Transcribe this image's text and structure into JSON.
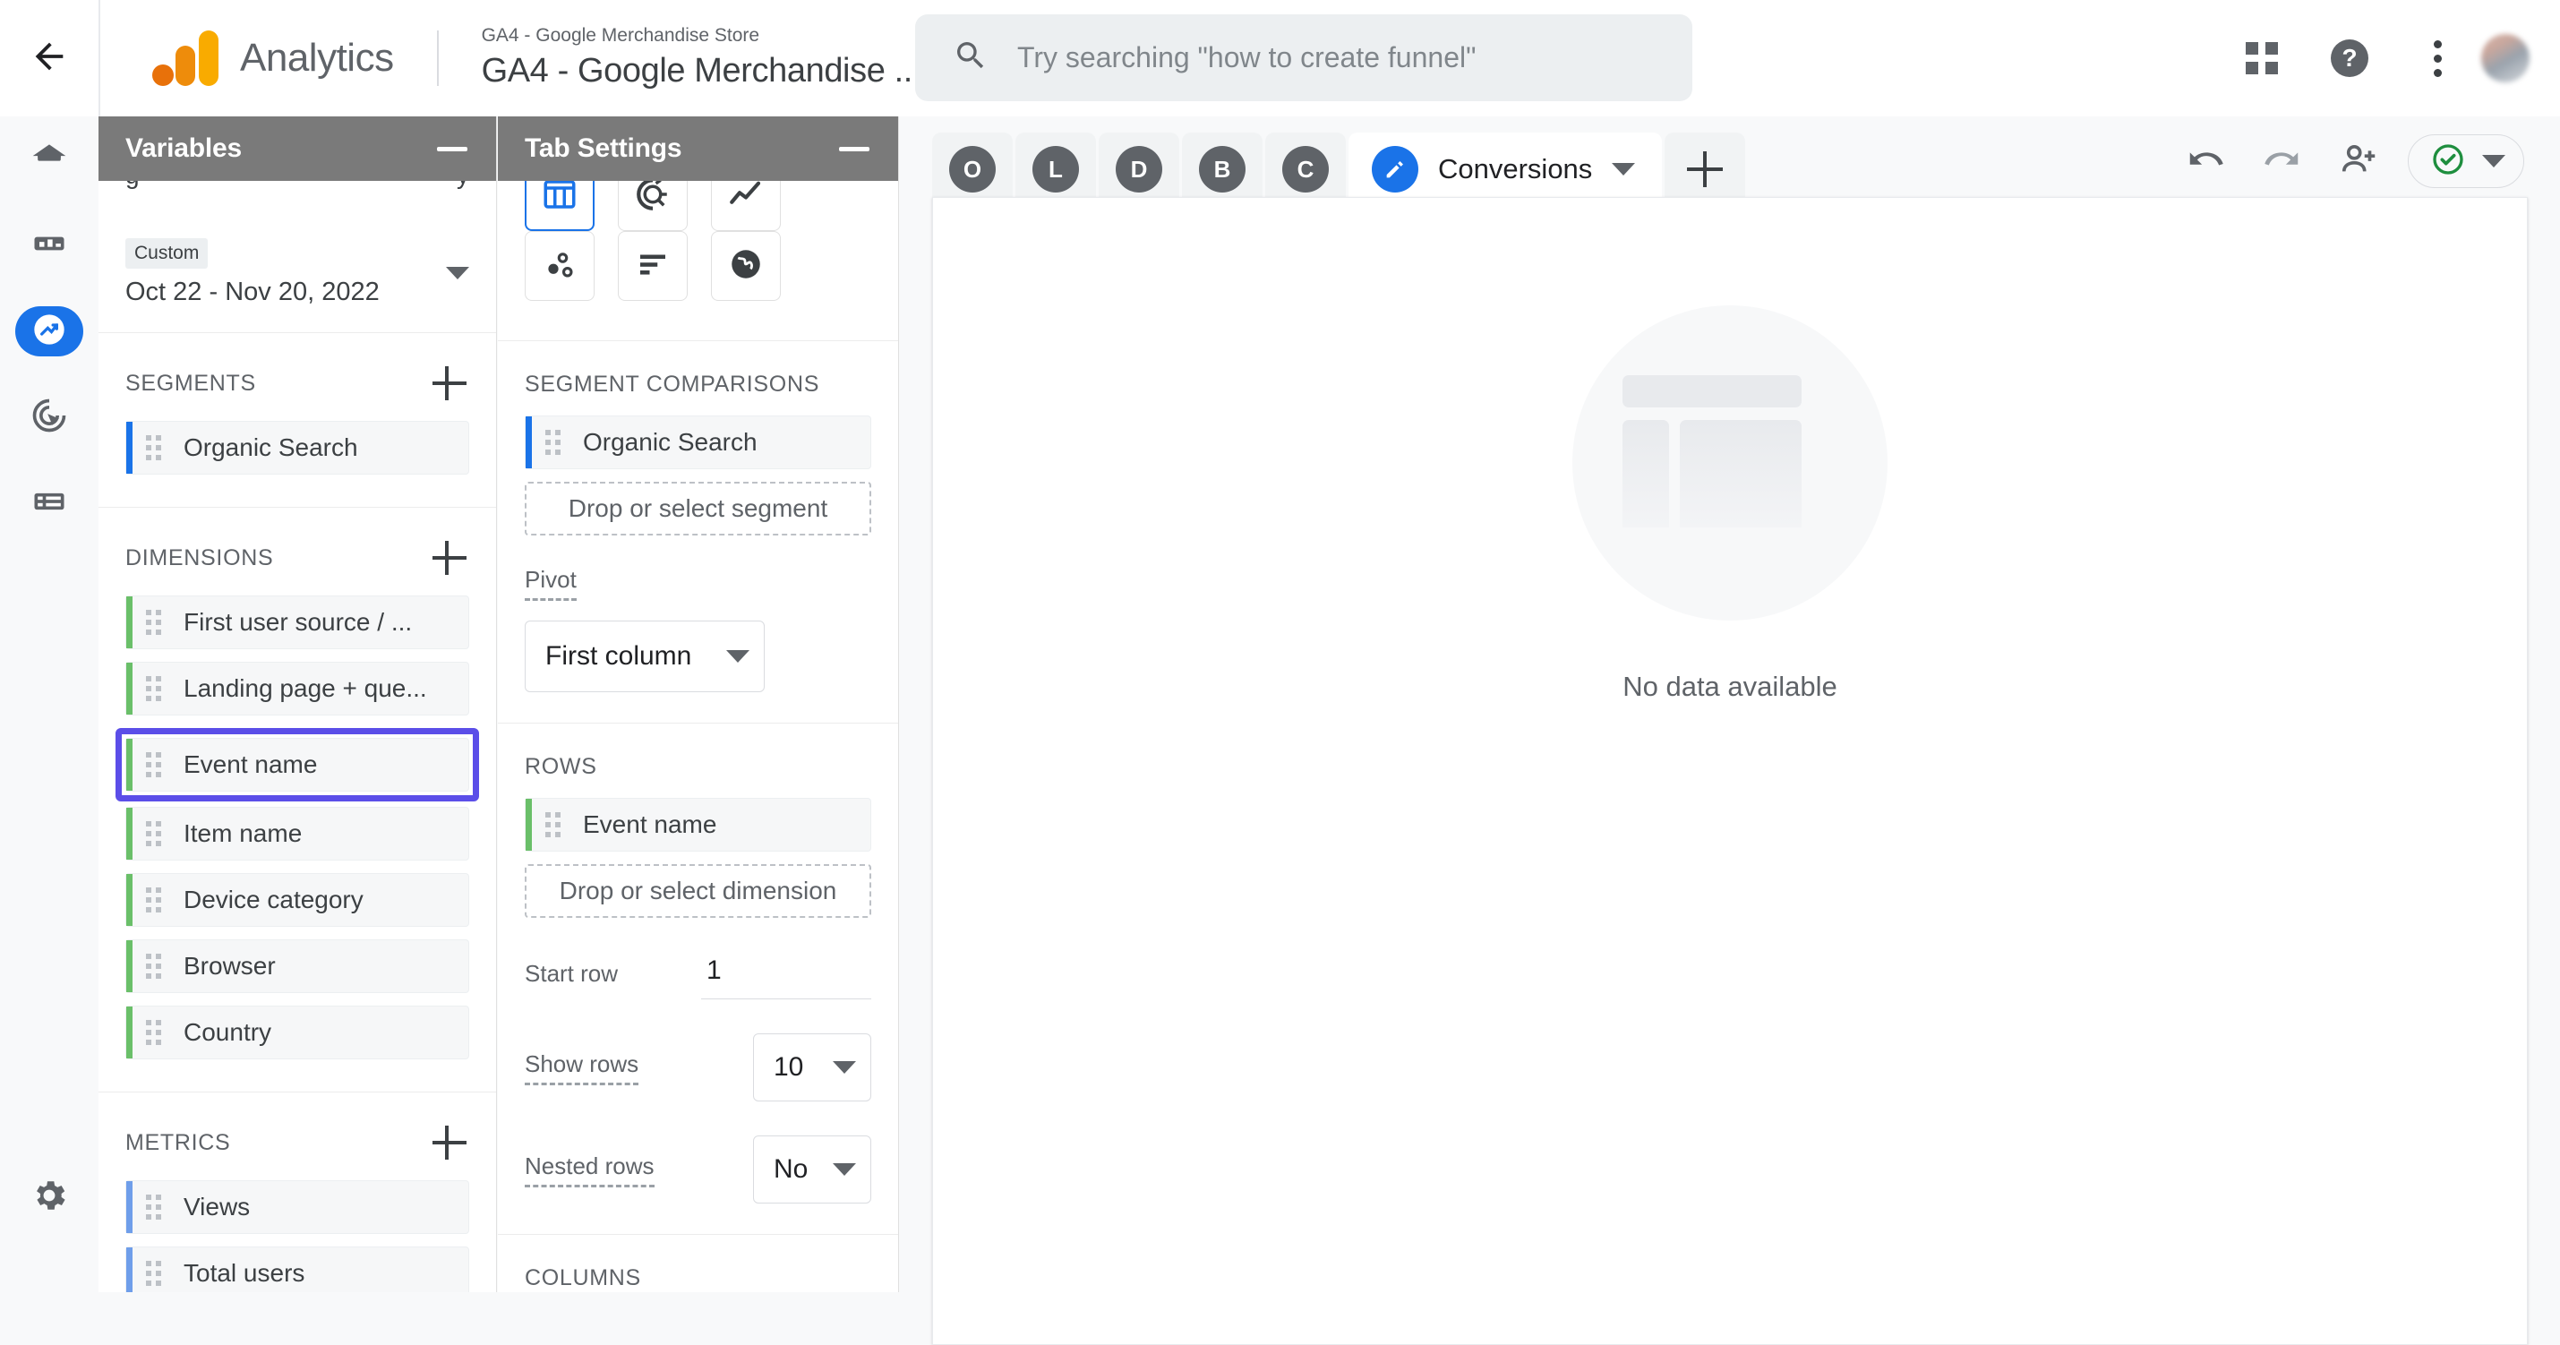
{
  "topbar": {
    "back_icon": "arrow-left-icon",
    "brand_name": "Analytics",
    "property_subtitle": "GA4 - Google Merchandise Store",
    "property_title": "GA4 - Google Merchandise ...",
    "search_placeholder": "Try searching \"how to create funnel\"",
    "search_value": "",
    "apps_icon": "apps-grid-icon",
    "help_icon": "help-circle-icon",
    "help_glyph": "?",
    "more_icon": "more-vert-icon",
    "avatar_icon": "user-avatar"
  },
  "rail": {
    "items": [
      {
        "name": "home",
        "icon": "home-icon",
        "active": false
      },
      {
        "name": "reports",
        "icon": "bar-chart-icon",
        "active": false
      },
      {
        "name": "explore",
        "icon": "explore-compass-icon",
        "active": true
      },
      {
        "name": "advertising",
        "icon": "advertising-target-icon",
        "active": false
      },
      {
        "name": "configure",
        "icon": "list-config-icon",
        "active": false
      }
    ],
    "settings": {
      "name": "admin-settings",
      "icon": "gear-icon"
    }
  },
  "variables": {
    "title": "Variables",
    "minimize_icon": "minimize-icon",
    "date": {
      "badge": "Custom",
      "range": "Oct 22 - Nov 20, 2022",
      "caret_icon": "chevron-down-icon"
    },
    "segments": {
      "title": "SEGMENTS",
      "add_icon": "plus-icon",
      "items": [
        "Organic Search"
      ]
    },
    "dimensions": {
      "title": "DIMENSIONS",
      "add_icon": "plus-icon",
      "items": [
        "First user source / ...",
        "Landing page + que...",
        "Event name",
        "Item name",
        "Device category",
        "Browser",
        "Country"
      ],
      "highlighted": "Event name",
      "highlight_color": "#5b4ee8"
    },
    "metrics": {
      "title": "METRICS",
      "add_icon": "plus-icon",
      "items": [
        "Views",
        "Total users"
      ]
    },
    "accent_colors": {
      "dimension": "#6abf69",
      "metric": "#6f9eea",
      "segment": "#1a73e8"
    }
  },
  "tab_settings": {
    "title": "Tab Settings",
    "minimize_icon": "minimize-icon",
    "technique_label": "",
    "chart_types": [
      {
        "name": "free-form-table-icon",
        "selected": true
      },
      {
        "name": "donut-chart-icon",
        "selected": false
      },
      {
        "name": "line-chart-icon",
        "selected": false
      },
      {
        "name": "scatter-plot-icon",
        "selected": false
      },
      {
        "name": "bar-chart-icon",
        "selected": false
      },
      {
        "name": "geo-map-icon",
        "selected": false
      }
    ],
    "segment_comparisons": {
      "title": "SEGMENT COMPARISONS",
      "items": [
        "Organic Search"
      ],
      "drop_label": "Drop or select segment"
    },
    "pivot": {
      "label": "Pivot",
      "value": "First column",
      "caret_icon": "chevron-down-icon"
    },
    "rows": {
      "title": "ROWS",
      "items": [
        "Event name"
      ],
      "drop_label": "Drop or select dimension",
      "start_row_label": "Start row",
      "start_row_value": "1",
      "show_rows_label": "Show rows",
      "show_rows_value": "10",
      "nested_rows_label": "Nested rows",
      "nested_rows_value": "No"
    },
    "columns": {
      "title": "COLUMNS"
    }
  },
  "main": {
    "tabs": [
      {
        "label": "O",
        "type": "mini"
      },
      {
        "label": "L",
        "type": "mini"
      },
      {
        "label": "D",
        "type": "mini"
      },
      {
        "label": "B",
        "type": "mini"
      },
      {
        "label": "C",
        "type": "mini"
      }
    ],
    "active_tab": {
      "label": "Conversions",
      "icon": "pencil-icon",
      "caret_icon": "chevron-down-icon"
    },
    "add_tab_icon": "plus-icon",
    "actions": [
      {
        "name": "undo-icon"
      },
      {
        "name": "redo-icon"
      },
      {
        "name": "share-add-person-icon"
      }
    ],
    "status": {
      "icon": "check-circle-icon",
      "color": "#1e8e3e",
      "caret_icon": "chevron-down-icon"
    },
    "empty_state": {
      "icon": "empty-table-placeholder-icon",
      "text": "No data available"
    }
  }
}
